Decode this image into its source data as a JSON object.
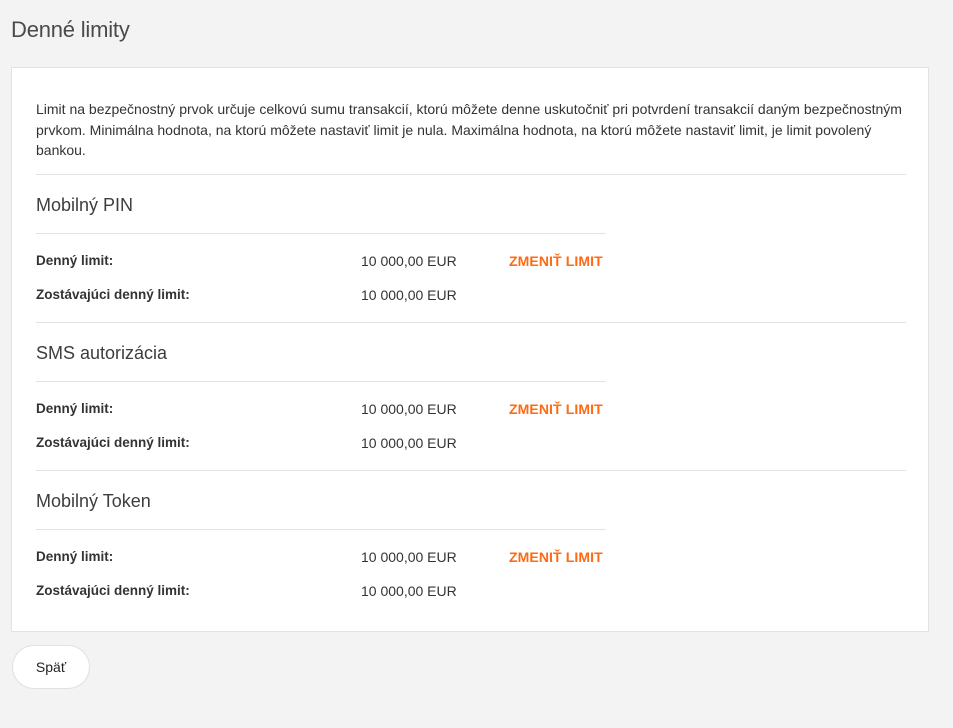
{
  "page": {
    "title": "Denné limity"
  },
  "intro": {
    "text": "Limit na bezpečnostný prvok určuje celkovú sumu transakcií, ktorú môžete denne uskutočniť pri potvrdení transakcií daným bezpečnostným prvkom. Minimálna hodnota, na ktorú môžete nastaviť limit je nula. Maximálna hodnota, na ktorú môžete nastaviť limit, je limit povolený bankou."
  },
  "sections": [
    {
      "title": "Mobilný PIN",
      "daily_label": "Denný limit:",
      "daily_value": "10 000,00 EUR",
      "remaining_label": "Zostávajúci denný limit:",
      "remaining_value": "10 000,00 EUR",
      "change_label": "ZMENIŤ LIMIT"
    },
    {
      "title": "SMS autorizácia",
      "daily_label": "Denný limit:",
      "daily_value": "10 000,00 EUR",
      "remaining_label": "Zostávajúci denný limit:",
      "remaining_value": "10 000,00 EUR",
      "change_label": "ZMENIŤ LIMIT"
    },
    {
      "title": "Mobilný Token",
      "daily_label": "Denný limit:",
      "daily_value": "10 000,00 EUR",
      "remaining_label": "Zostávajúci denný limit:",
      "remaining_value": "10 000,00 EUR",
      "change_label": "ZMENIŤ LIMIT"
    }
  ],
  "footer": {
    "back_label": "Späť"
  },
  "colors": {
    "accent": "#ff6a13",
    "background": "#f3f3f3",
    "card": "#ffffff"
  }
}
